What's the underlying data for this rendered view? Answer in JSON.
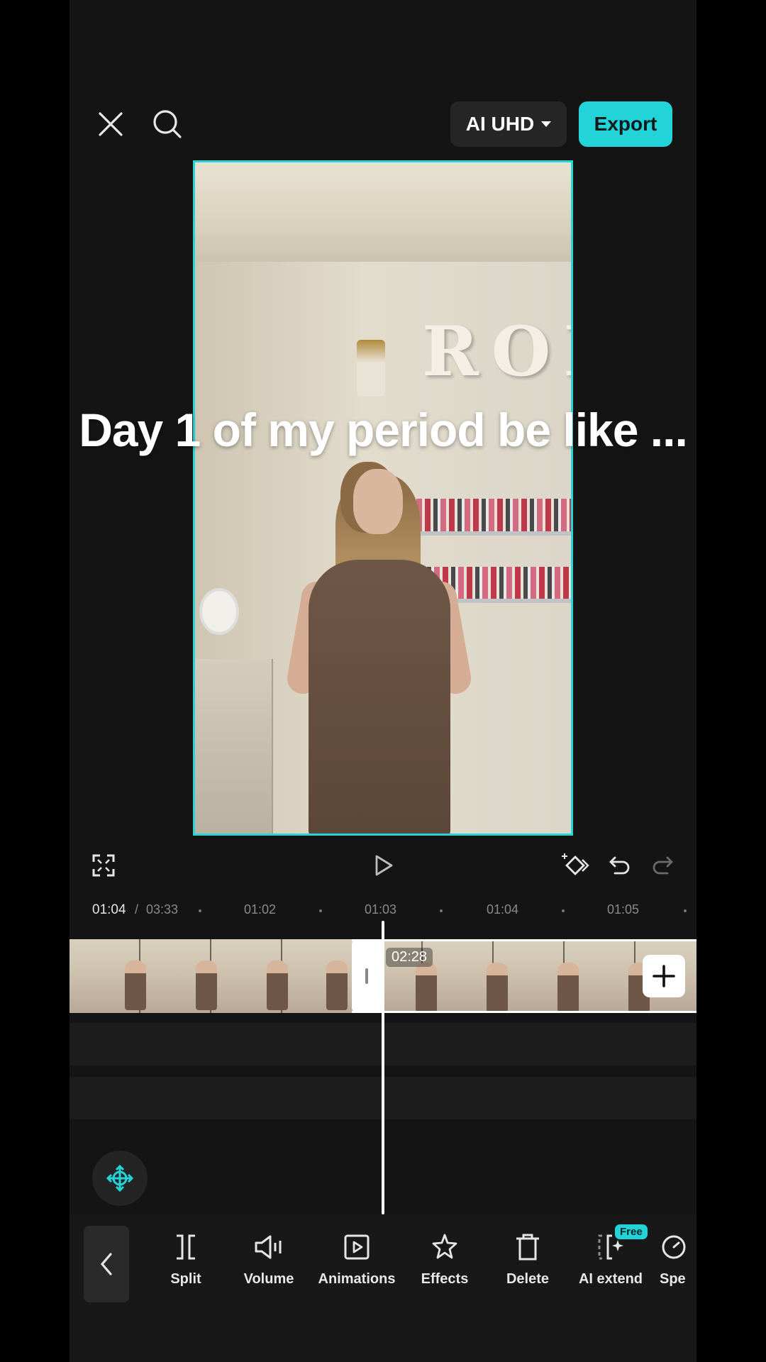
{
  "header": {
    "close_icon": "close-icon",
    "search_icon": "search-icon",
    "quality_label": "AI UHD",
    "export_label": "Export"
  },
  "preview": {
    "caption": "Day 1 of my period be like ...",
    "scene_text": "ROK",
    "frame_color": "#2ad5d8"
  },
  "controls": {
    "fullscreen_icon": "fullscreen-icon",
    "play_icon": "play-icon",
    "keyframe_icon": "keyframe-icon",
    "undo_icon": "undo-icon",
    "redo_icon": "redo-icon"
  },
  "ruler": {
    "current": "01:04",
    "separator": "/",
    "total": "03:33",
    "ticks": [
      "01:02",
      "01:03",
      "01:04",
      "01:05"
    ]
  },
  "timeline": {
    "clip_duration": "02:28",
    "add_icon": "plus-icon"
  },
  "toolbar": {
    "items": [
      {
        "label": "Split",
        "icon": "split-icon"
      },
      {
        "label": "Volume",
        "icon": "volume-icon"
      },
      {
        "label": "Animations",
        "icon": "animations-icon"
      },
      {
        "label": "Effects",
        "icon": "effects-icon"
      },
      {
        "label": "Delete",
        "icon": "delete-icon"
      },
      {
        "label": "AI extend",
        "icon": "ai-extend-icon",
        "badge": "Free"
      },
      {
        "label": "Spe",
        "icon": "speed-icon"
      }
    ]
  },
  "colors": {
    "accent": "#22d3d8",
    "background": "#141414"
  }
}
